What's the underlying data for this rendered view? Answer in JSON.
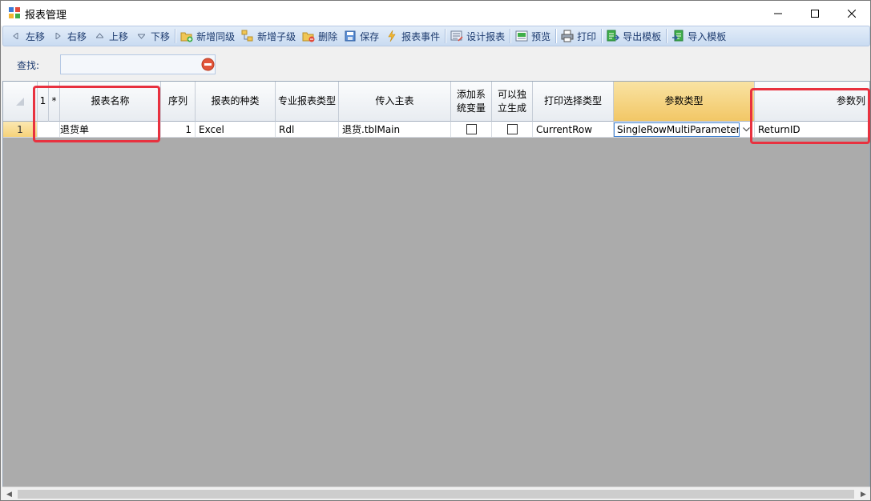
{
  "window": {
    "title": "报表管理"
  },
  "toolbar": {
    "items": [
      {
        "label": "左移",
        "icon": "triangle-left-icon"
      },
      {
        "label": "右移",
        "icon": "triangle-right-icon"
      },
      {
        "label": "上移",
        "icon": "triangle-up-icon"
      },
      {
        "label": "下移",
        "icon": "triangle-down-icon"
      },
      {
        "label": "新增同级",
        "icon": "folder-add-icon"
      },
      {
        "label": "新增子级",
        "icon": "tree-add-icon"
      },
      {
        "label": "删除",
        "icon": "folder-delete-icon"
      },
      {
        "label": "保存",
        "icon": "save-icon"
      },
      {
        "label": "报表事件",
        "icon": "lightning-icon"
      },
      {
        "label": "设计报表",
        "icon": "design-icon"
      },
      {
        "label": "预览",
        "icon": "preview-icon"
      },
      {
        "label": "打印",
        "icon": "printer-icon"
      },
      {
        "label": "导出模板",
        "icon": "export-icon"
      },
      {
        "label": "导入模板",
        "icon": "import-icon"
      }
    ]
  },
  "search": {
    "label": "查找:",
    "value": ""
  },
  "grid": {
    "columns": {
      "marker1": "1",
      "marker2": "*",
      "name": "报表名称",
      "order": "序列",
      "kind": "报表的种类",
      "pro_type": "专业报表类型",
      "main_table": "传入主表",
      "add_sys_var": "添加系统变量",
      "independent": "可以独立生成",
      "print_select": "打印选择类型",
      "param_type": "参数类型",
      "param_cols": "参数列"
    },
    "rows": [
      {
        "row_number": "1",
        "name": "退货单",
        "order": "1",
        "kind": "Excel",
        "pro_type": "Rdl",
        "main_table": "退货.tblMain",
        "add_sys_var": false,
        "independent": false,
        "print_select": "CurrentRow",
        "param_type": "SingleRowMultiParameter",
        "param_cols": "ReturnID"
      }
    ]
  },
  "colors": {
    "highlight": "#e8313f",
    "sorted_header": "#f2c766",
    "grid_background": "#ababab"
  }
}
